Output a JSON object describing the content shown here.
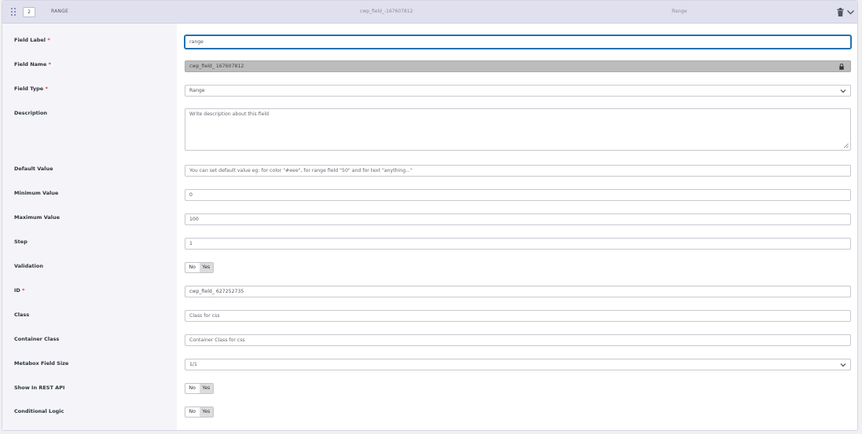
{
  "header": {
    "order": "2",
    "type": "RANGE",
    "field_name": "cwp_field_-167607812",
    "field_label": "Range"
  },
  "icons": {
    "drag": "drag-handle-icon",
    "trash": "trash-icon",
    "chevron": "chevron-down-icon",
    "lock": "lock-icon"
  },
  "colors": {
    "header_bg": "#e1e0ef",
    "label_col_bg": "#f5f5f9",
    "focus": "#2271b1",
    "required": "#d63638",
    "locked_bg": "#bcbcbc"
  },
  "required_mark": "*",
  "fields": {
    "field_label": {
      "label": "Field Label",
      "value": "range"
    },
    "field_name": {
      "label": "Field Name",
      "value": "cwp_field_ 167607812"
    },
    "field_type": {
      "label": "Field Type",
      "value": "Range"
    },
    "description": {
      "label": "Description",
      "placeholder": "Write description about this field"
    },
    "default_value": {
      "label": "Default Value",
      "placeholder": "You can set default value eg: for color \"#eee\", for range field \"50\" and for text \"anything...\""
    },
    "min_value": {
      "label": "Minimum Value",
      "value": "0"
    },
    "max_value": {
      "label": "Maximum Value",
      "value": "100"
    },
    "step": {
      "label": "Step",
      "value": "1"
    },
    "validation": {
      "label": "Validation",
      "no": "No",
      "yes": "Yes"
    },
    "id": {
      "label": "ID",
      "value": "cwp_field_ 627252735"
    },
    "class": {
      "label": "Class",
      "placeholder": "Class for css"
    },
    "container_class": {
      "label": "Container Class",
      "placeholder": "Container Class for css"
    },
    "metabox_size": {
      "label": "Metabox Field Size",
      "value": "1/1"
    },
    "rest_api": {
      "label": "Show In REST API",
      "no": "No",
      "yes": "Yes"
    },
    "conditional_logic": {
      "label": "Conditional Logic",
      "no": "No",
      "yes": "Yes"
    }
  }
}
